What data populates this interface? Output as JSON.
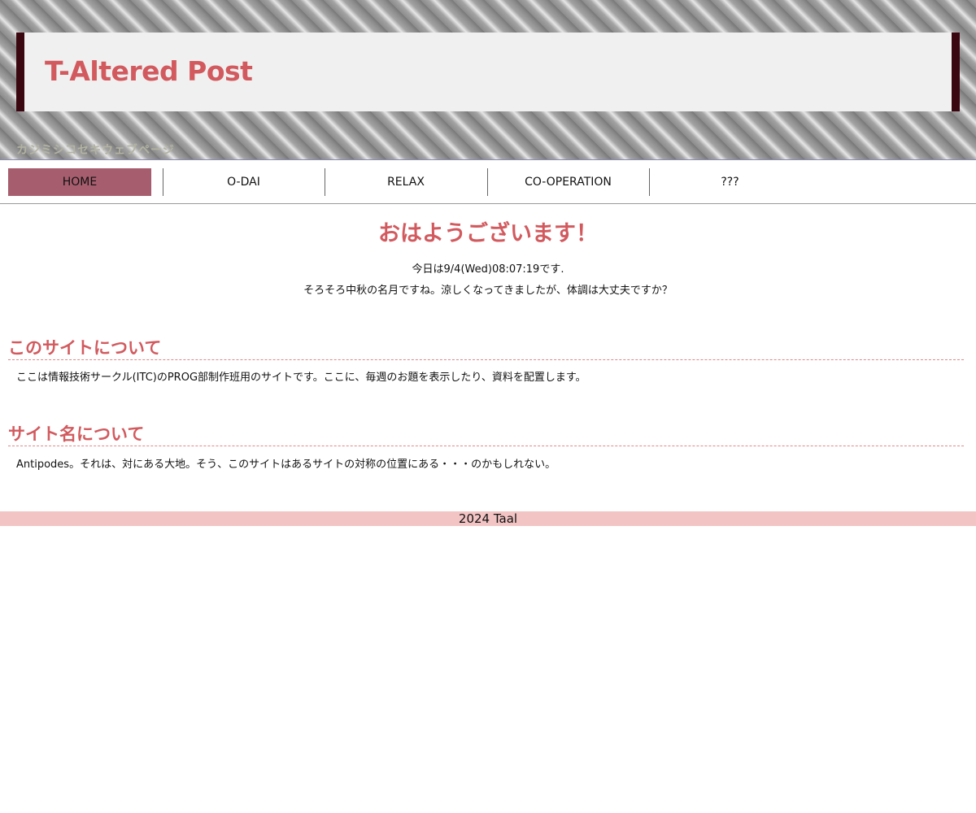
{
  "header": {
    "site_title": "T-Altered Post",
    "subtitle": "カジミシコセキウェブページ"
  },
  "nav": {
    "items": [
      {
        "label": "HOME",
        "active": true
      },
      {
        "label": "O-DAI",
        "active": false
      },
      {
        "label": "RELAX",
        "active": false
      },
      {
        "label": "CO-OPERATION",
        "active": false
      },
      {
        "label": "???",
        "active": false
      }
    ]
  },
  "main": {
    "greeting": "おはようございます！",
    "date_line": "今日は9/4(Wed)08:07:19です.",
    "season_line": "そろそろ中秋の名月ですね。涼しくなってきましたが、体調は大丈夫ですか？",
    "sections": [
      {
        "title": "このサイトについて",
        "text": "ここは情報技術サークル(ITC)のPROG部制作班用のサイトです。ここに、毎週のお題を表示したり、資料を配置します。"
      },
      {
        "title": "サイト名について",
        "text": "Antipodes。それは、対にある大地。そう、このサイトはあるサイトの対称の位置にある・・・のかもしれない。"
      }
    ]
  },
  "footer": {
    "text": "2024 Taal"
  },
  "colors": {
    "accent": "#d25a5e",
    "nav_active": "#a65e6e",
    "title_border": "#3a0710",
    "footer_bg": "#f2c4c4"
  }
}
